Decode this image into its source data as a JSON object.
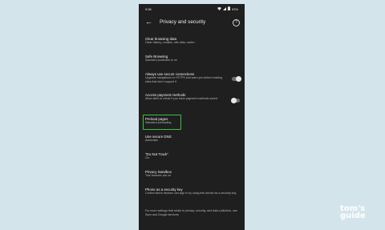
{
  "status": {
    "time": "9:56",
    "battery": "92%"
  },
  "header": {
    "title": "Privacy and security",
    "back_icon": "arrow-left-icon",
    "help_icon": "help-circle-icon"
  },
  "settings": [
    {
      "title": "Clear browsing data",
      "subtitle": "Clear history, cookies, site data, cache..."
    },
    {
      "title": "Safe Browsing",
      "subtitle": "Standard protection is on"
    },
    {
      "title": "Always use secure connections",
      "subtitle": "Upgrade navigations to HTTPS and warn you before loading sites that don't support it",
      "toggle": "off"
    },
    {
      "title": "Access payment methods",
      "subtitle": "Allow sites to check if you have payment methods saved",
      "toggle": "off"
    },
    {
      "title": "Preload pages",
      "subtitle": "Standard preloading"
    },
    {
      "title": "Use secure DNS",
      "subtitle": "Automatic"
    },
    {
      "title": "\"Do Not Track\"",
      "subtitle": "On"
    },
    {
      "title": "Privacy Sandbox",
      "subtitle": "Trial features are on"
    },
    {
      "title": "Phone as a security key",
      "subtitle": "Control which devices can sign in by using this device as a security key."
    }
  ],
  "footer": "For more settings that relate to privacy, security, and data collection, see Sync and Google services",
  "watermark": {
    "line1": "tom's",
    "line2": "guide"
  },
  "colors": {
    "background": "#d3e5ea",
    "screen": "#1f1f1f",
    "highlight": "#3fbf44"
  }
}
